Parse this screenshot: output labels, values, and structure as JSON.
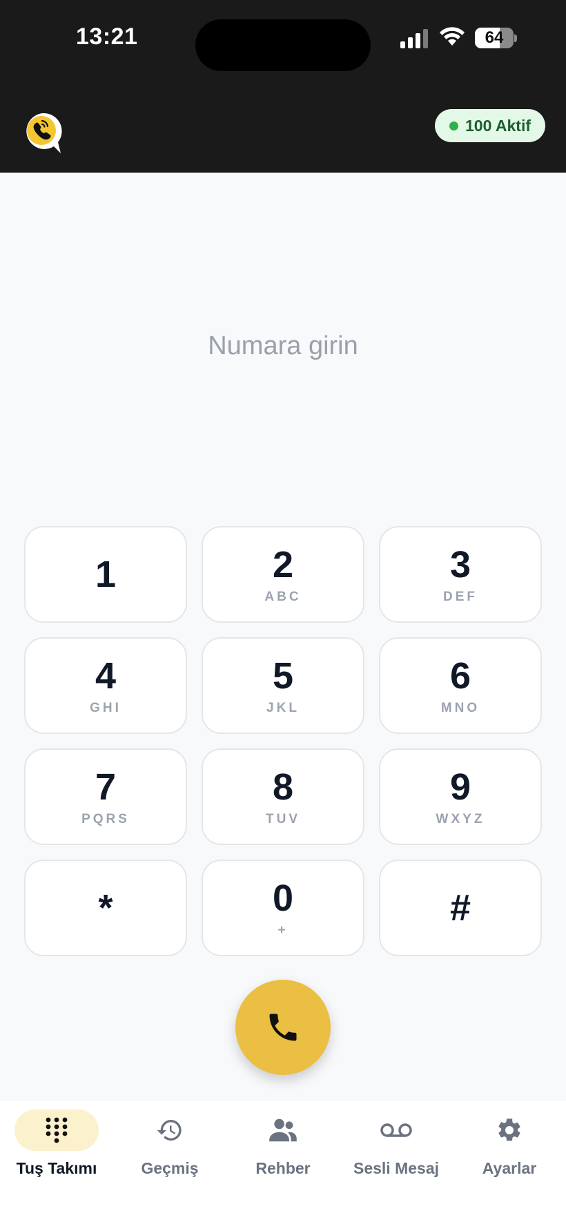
{
  "status_bar": {
    "time": "13:21",
    "battery": "64",
    "battery_level": 0.64
  },
  "header": {
    "logo_icon": "phone-chat-logo-icon",
    "active_badge": "100 Aktif",
    "accent_color": "#ebbe44",
    "badge_dot_color": "#2fae4e"
  },
  "dialer": {
    "number_placeholder": "Numara girin",
    "keys": [
      {
        "digit": "1",
        "letters": ""
      },
      {
        "digit": "2",
        "letters": "ABC"
      },
      {
        "digit": "3",
        "letters": "DEF"
      },
      {
        "digit": "4",
        "letters": "GHI"
      },
      {
        "digit": "5",
        "letters": "JKL"
      },
      {
        "digit": "6",
        "letters": "MNO"
      },
      {
        "digit": "7",
        "letters": "PQRS"
      },
      {
        "digit": "8",
        "letters": "TUV"
      },
      {
        "digit": "9",
        "letters": "WXYZ"
      },
      {
        "digit": "*",
        "letters": ""
      },
      {
        "digit": "0",
        "letters": "+"
      },
      {
        "digit": "#",
        "letters": ""
      }
    ],
    "call_icon": "phone-icon"
  },
  "tabbar": {
    "tabs": [
      {
        "label": "Tuş Takımı",
        "icon": "dialpad-icon",
        "active": true
      },
      {
        "label": "Geçmiş",
        "icon": "history-icon",
        "active": false
      },
      {
        "label": "Rehber",
        "icon": "contacts-icon",
        "active": false
      },
      {
        "label": "Sesli Mesaj",
        "icon": "voicemail-icon",
        "active": false
      },
      {
        "label": "Ayarlar",
        "icon": "settings-icon",
        "active": false
      }
    ]
  }
}
